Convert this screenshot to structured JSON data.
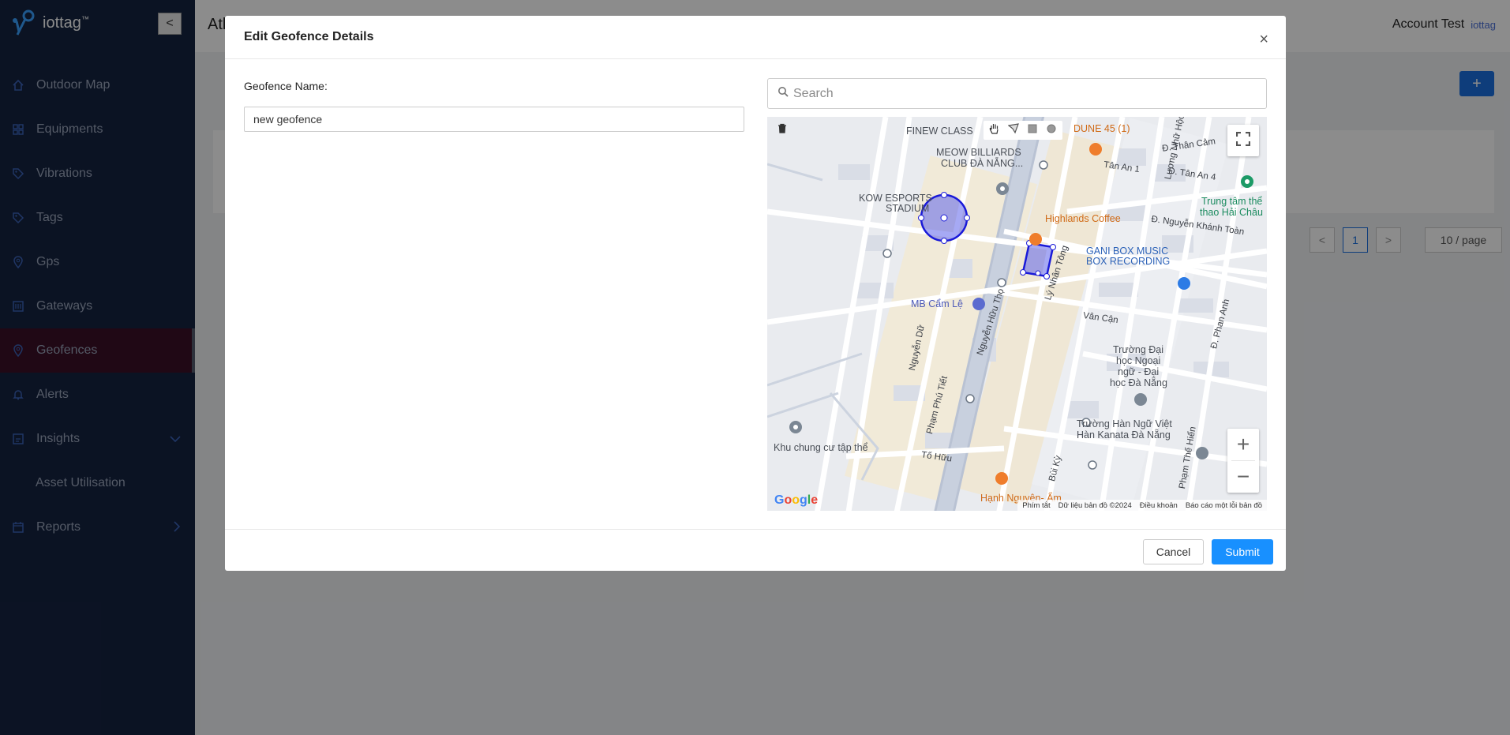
{
  "app": {
    "name": "iottag",
    "trademark": "™"
  },
  "sidebar": {
    "collapse_label": "<",
    "items": [
      {
        "label": "Outdoor Map",
        "icon": "home-icon"
      },
      {
        "label": "Equipments",
        "icon": "grid-icon"
      },
      {
        "label": "Vibrations",
        "icon": "tag-icon"
      },
      {
        "label": "Tags",
        "icon": "tag-icon"
      },
      {
        "label": "Gps",
        "icon": "location-pin-icon"
      },
      {
        "label": "Gateways",
        "icon": "gateway-icon"
      },
      {
        "label": "Geofences",
        "icon": "location-pin-icon",
        "active": true
      },
      {
        "label": "Alerts",
        "icon": "bell-icon"
      },
      {
        "label": "Insights",
        "icon": "chart-icon",
        "expanded": true
      },
      {
        "label": "Asset Utilisation",
        "sub": true
      },
      {
        "label": "Reports",
        "icon": "calendar-icon"
      }
    ]
  },
  "header": {
    "title": "Atl",
    "account": "Account Test",
    "account_logo": "iottag"
  },
  "background": {
    "add_label": "+",
    "pagination": {
      "prev": "<",
      "current": "1",
      "next": ">",
      "page_size": "10 / page"
    }
  },
  "modal": {
    "title": "Edit Geofence Details",
    "close_label": "×",
    "name_label": "Geofence Name:",
    "name_value": "new geofence",
    "search_placeholder": "Search",
    "cancel_label": "Cancel",
    "submit_label": "Submit"
  },
  "map": {
    "labels": {
      "finew": "FINEW CLASS",
      "billiards": "MEOW BILLIARDS",
      "billiards2": "CLUB ĐÀ NẴNG...",
      "dune": "DUNE 45 (1)",
      "kow": "KOW ESPORTS",
      "stadium": "STADIUM",
      "highlands": "Highlands Coffee",
      "gani": "GANI BOX MUSIC",
      "gani2": "BOX RECORDING",
      "mb": "MB Cẩm Lệ",
      "trung_tam": "Trung tâm thể",
      "thao": "thao Hải Châu",
      "nguyen_khanh_toan": "Đ. Nguyễn Khánh Toàn",
      "than_cam": "Đ. Thân Cảm",
      "tan_an_1": "Tân An 1",
      "tan_an_4": "Đ. Tân An 4",
      "van_can": "Vân Cận",
      "truong_dai": "Trường Đại",
      "hoc_ngoai": "học Ngoại",
      "ngu_dai": "ngữ - Đại",
      "hoc_da_nang": "học Đà Nẵng",
      "han_ngu": "Trường Hàn Ngữ Việt",
      "kanata": "Hàn Kanata Đà Nẵng",
      "khu_chung_cu": "Khu chung cư tập thể",
      "hanh_nguyen": "Hạnh Nguyên- Ẩm",
      "nguyen_huu_tho": "Nguyễn Hữu Thọ",
      "ly_nhan_tong": "Lý Nhân Tông",
      "pham_phu_tiet": "Phạm Phú Tiết",
      "nguyen_du": "Nguyễn Dữ",
      "to_huu": "Tố Hữu",
      "bui_ky": "Bùi Kỳ",
      "phan_anh": "Đ. Phan Anh",
      "luong_nhu_hoc": "Lương Nhữ Hộc",
      "pham_the_hien": "Phạm Thế Hiển"
    },
    "google": "Google",
    "attribution": {
      "shortcuts": "Phím tắt",
      "data": "Dữ liệu bản đồ ©2024",
      "terms": "Điều khoản",
      "report": "Báo cáo một lỗi bản đồ"
    },
    "zoom_in": "+",
    "zoom_out": "−"
  }
}
